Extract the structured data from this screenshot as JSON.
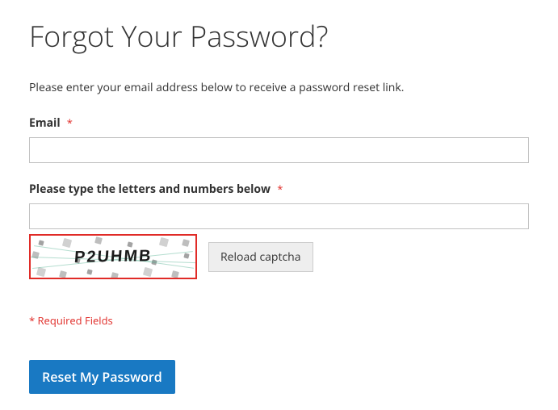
{
  "heading": "Forgot Your Password?",
  "instruction": "Please enter your email address below to receive a password reset link.",
  "email": {
    "label": "Email",
    "value": ""
  },
  "captcha": {
    "label": "Please type the letters and numbers below",
    "value": "",
    "image_text": "P2UHMB",
    "reload_label": "Reload captcha"
  },
  "required_note": "* Required Fields",
  "submit_label": "Reset My Password",
  "asterisk": "*"
}
